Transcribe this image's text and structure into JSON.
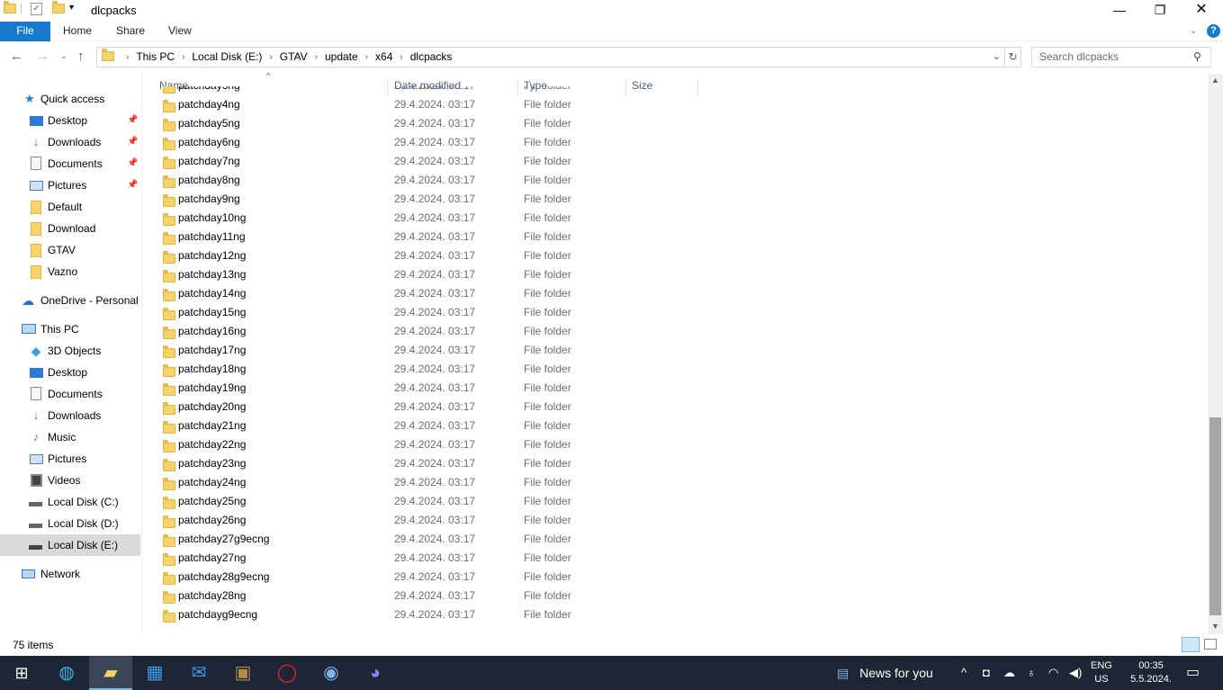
{
  "window": {
    "title": "dlcpacks"
  },
  "ribbon": {
    "tabs": [
      "File",
      "Home",
      "Share",
      "View"
    ]
  },
  "address": {
    "crumbs": [
      "This PC",
      "Local Disk (E:)",
      "GTAV",
      "update",
      "x64",
      "dlcpacks"
    ]
  },
  "search": {
    "placeholder": "Search dlcpacks"
  },
  "navpane": {
    "quick_access": "Quick access",
    "quick_items": [
      "Desktop",
      "Downloads",
      "Documents",
      "Pictures",
      "Default",
      "Download",
      "GTAV",
      "Vazno"
    ],
    "onedrive": "OneDrive - Personal",
    "this_pc": "This PC",
    "pc_items": [
      "3D Objects",
      "Desktop",
      "Documents",
      "Downloads",
      "Music",
      "Pictures",
      "Videos",
      "Local Disk (C:)",
      "Local Disk (D:)",
      "Local Disk (E:)"
    ],
    "network": "Network"
  },
  "columns": {
    "name": "Name",
    "date": "Date modified",
    "type": "Type",
    "size": "Size"
  },
  "files": [
    {
      "name": "patchday3ng",
      "date": "29.4.2024. 03:17",
      "type": "File folder"
    },
    {
      "name": "patchday4ng",
      "date": "29.4.2024. 03:17",
      "type": "File folder"
    },
    {
      "name": "patchday5ng",
      "date": "29.4.2024. 03:17",
      "type": "File folder"
    },
    {
      "name": "patchday6ng",
      "date": "29.4.2024. 03:17",
      "type": "File folder"
    },
    {
      "name": "patchday7ng",
      "date": "29.4.2024. 03:17",
      "type": "File folder"
    },
    {
      "name": "patchday8ng",
      "date": "29.4.2024. 03:17",
      "type": "File folder"
    },
    {
      "name": "patchday9ng",
      "date": "29.4.2024. 03:17",
      "type": "File folder"
    },
    {
      "name": "patchday10ng",
      "date": "29.4.2024. 03:17",
      "type": "File folder"
    },
    {
      "name": "patchday11ng",
      "date": "29.4.2024. 03:17",
      "type": "File folder"
    },
    {
      "name": "patchday12ng",
      "date": "29.4.2024. 03:17",
      "type": "File folder"
    },
    {
      "name": "patchday13ng",
      "date": "29.4.2024. 03:17",
      "type": "File folder"
    },
    {
      "name": "patchday14ng",
      "date": "29.4.2024. 03:17",
      "type": "File folder"
    },
    {
      "name": "patchday15ng",
      "date": "29.4.2024. 03:17",
      "type": "File folder"
    },
    {
      "name": "patchday16ng",
      "date": "29.4.2024. 03:17",
      "type": "File folder"
    },
    {
      "name": "patchday17ng",
      "date": "29.4.2024. 03:17",
      "type": "File folder"
    },
    {
      "name": "patchday18ng",
      "date": "29.4.2024. 03:17",
      "type": "File folder"
    },
    {
      "name": "patchday19ng",
      "date": "29.4.2024. 03:17",
      "type": "File folder"
    },
    {
      "name": "patchday20ng",
      "date": "29.4.2024. 03:17",
      "type": "File folder"
    },
    {
      "name": "patchday21ng",
      "date": "29.4.2024. 03:17",
      "type": "File folder"
    },
    {
      "name": "patchday22ng",
      "date": "29.4.2024. 03:17",
      "type": "File folder"
    },
    {
      "name": "patchday23ng",
      "date": "29.4.2024. 03:17",
      "type": "File folder"
    },
    {
      "name": "patchday24ng",
      "date": "29.4.2024. 03:17",
      "type": "File folder"
    },
    {
      "name": "patchday25ng",
      "date": "29.4.2024. 03:17",
      "type": "File folder"
    },
    {
      "name": "patchday26ng",
      "date": "29.4.2024. 03:17",
      "type": "File folder"
    },
    {
      "name": "patchday27g9ecng",
      "date": "29.4.2024. 03:17",
      "type": "File folder"
    },
    {
      "name": "patchday27ng",
      "date": "29.4.2024. 03:17",
      "type": "File folder"
    },
    {
      "name": "patchday28g9ecng",
      "date": "29.4.2024. 03:17",
      "type": "File folder"
    },
    {
      "name": "patchday28ng",
      "date": "29.4.2024. 03:17",
      "type": "File folder"
    },
    {
      "name": "patchdayg9ecng",
      "date": "29.4.2024. 03:17",
      "type": "File folder"
    }
  ],
  "status": {
    "count": "75 items"
  },
  "taskbar": {
    "news": "News for you",
    "lang_top": "ENG",
    "lang_bottom": "US",
    "time": "00:35",
    "date": "5.5.2024."
  },
  "colors": {
    "accent": "#1979ca",
    "taskbar": "#1d2634",
    "folder": "#f6d26b"
  }
}
